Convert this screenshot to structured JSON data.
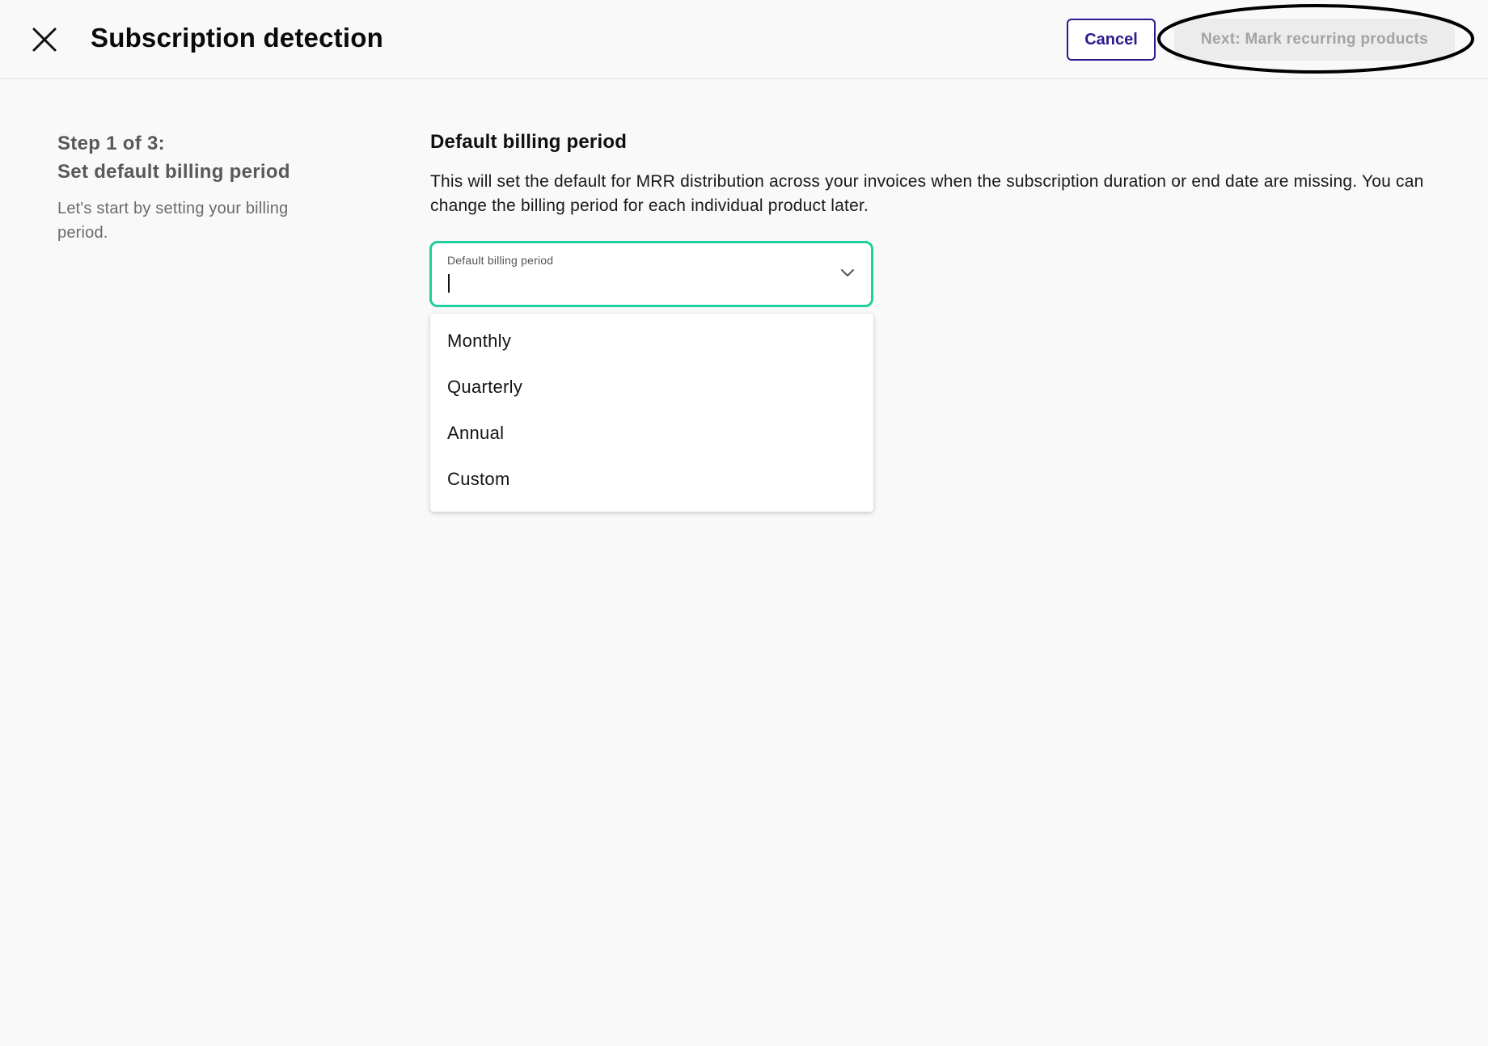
{
  "header": {
    "title": "Subscription detection",
    "cancel_label": "Cancel",
    "next_label": "Next: Mark recurring products",
    "close_icon": "close-icon",
    "highlight_color": "#000000"
  },
  "steps": {
    "step_line1": "Step 1 of 3:",
    "step_line2": "Set default billing period",
    "description": "Let's start by setting your billing period."
  },
  "billing": {
    "heading": "Default billing period",
    "description": "This will set the default for MRR distribution across your invoices when the subscription duration or end date are missing. You can change the billing period for each individual product later.",
    "select_label": "Default billing period",
    "select_value": "",
    "focus_color": "#1fcf9c",
    "options": [
      "Monthly",
      "Quarterly",
      "Annual",
      "Custom"
    ]
  },
  "colors": {
    "brand": "#2a1a8c",
    "disabled_bg": "#ececec",
    "disabled_text": "#a3a3a3"
  }
}
